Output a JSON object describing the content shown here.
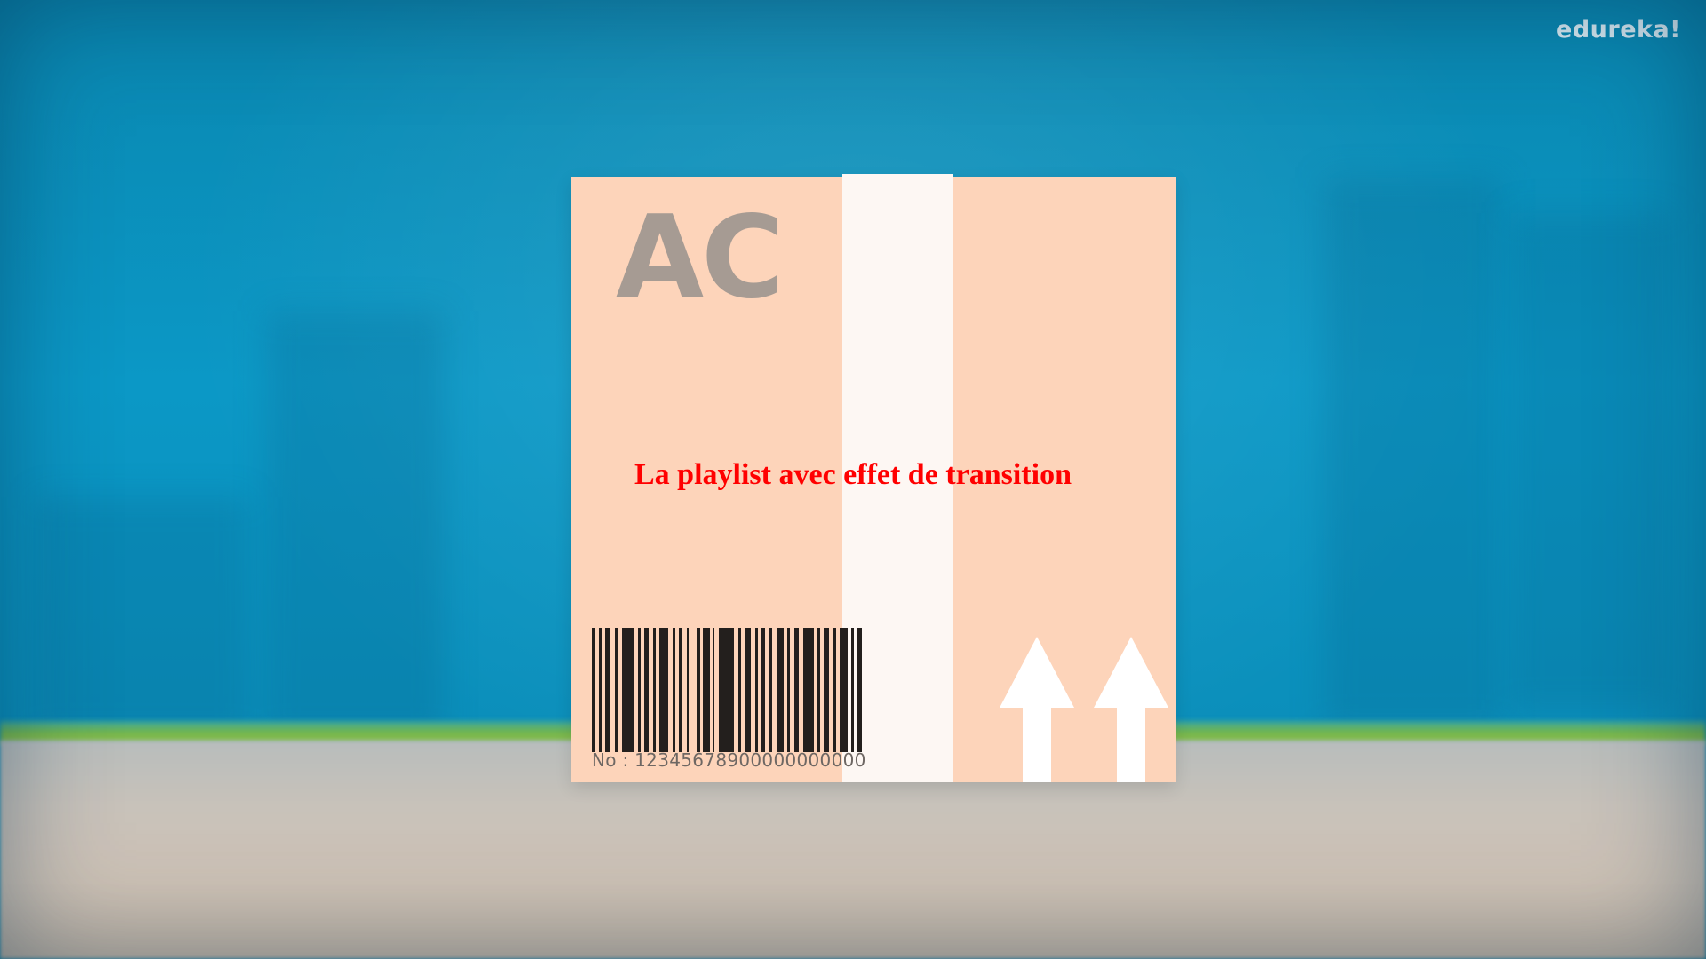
{
  "watermark": {
    "logo_text": "edureka!"
  },
  "box": {
    "code": "AC",
    "barcode_number": "No : 12345678900000000000",
    "colors": {
      "box": "#fdd4ba",
      "tape": "#fdf7f3",
      "code_text": "#a69b93"
    }
  },
  "caption": {
    "text": "La playlist avec effet de transition",
    "color": "#ff0000"
  },
  "icons": {
    "arrows": "this-side-up-arrows-icon",
    "barcode": "barcode-icon"
  }
}
